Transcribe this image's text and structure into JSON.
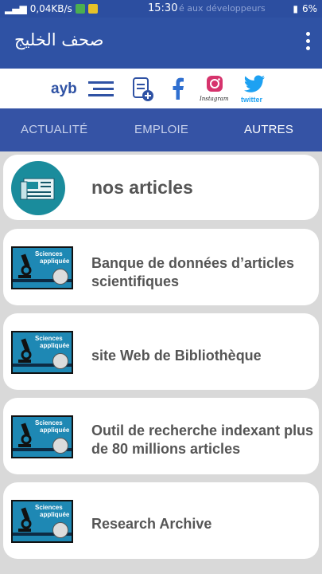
{
  "status_bar": {
    "network_speed": "0,04KB/s",
    "time": "15:30",
    "ghost_text": "é aux développeurs",
    "battery": "6%"
  },
  "app_bar": {
    "title": "صحف الخليج",
    "overflow_icon": "more-vert-icon"
  },
  "icon_bar": {
    "ayb_text": "ayb",
    "menu_icon": "menu-lines-icon",
    "add_note_icon": "add-document-icon",
    "facebook_icon": "facebook-icon",
    "instagram_icon": "instagram-icon",
    "instagram_caption": "Instagram",
    "twitter_icon": "twitter-icon",
    "twitter_caption": "twitter"
  },
  "tabs": [
    {
      "label": "ACTUALITÉ",
      "active": false
    },
    {
      "label": "EMPLOIE",
      "active": false
    },
    {
      "label": "AUTRES",
      "active": true
    }
  ],
  "header_card": {
    "icon": "newspaper-icon",
    "label": "nos articles"
  },
  "thumb": {
    "line1": "Sciences",
    "line2": "appliquée"
  },
  "items": [
    {
      "label": "Banque de données d’articles scientifiques"
    },
    {
      "label": "site Web de Bibliothèque"
    },
    {
      "label": "Outil de recherche indexant plus de 80 millions articles"
    },
    {
      "label": "Research Archive"
    }
  ],
  "colors": {
    "app_bar": "#2f52a4",
    "tab_bar": "#3553a5",
    "newspaper_circle": "#1a8c9c",
    "thumb_bg": "#1e88b4"
  }
}
